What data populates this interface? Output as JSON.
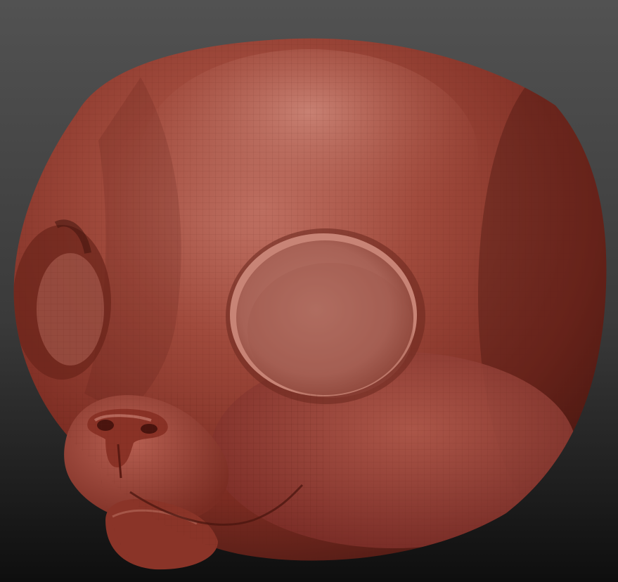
{
  "scene": {
    "subject_icon": "sculpted-creature-head-icon",
    "colors": {
      "background_top": "#525252",
      "background_bottom": "#0e0e0e",
      "clay_base": "#8a3428",
      "clay_highlight": "#c7786a",
      "clay_shadow": "#4a1812",
      "eye_socket": "#b07064",
      "mesh_line": "#5e2018"
    }
  }
}
